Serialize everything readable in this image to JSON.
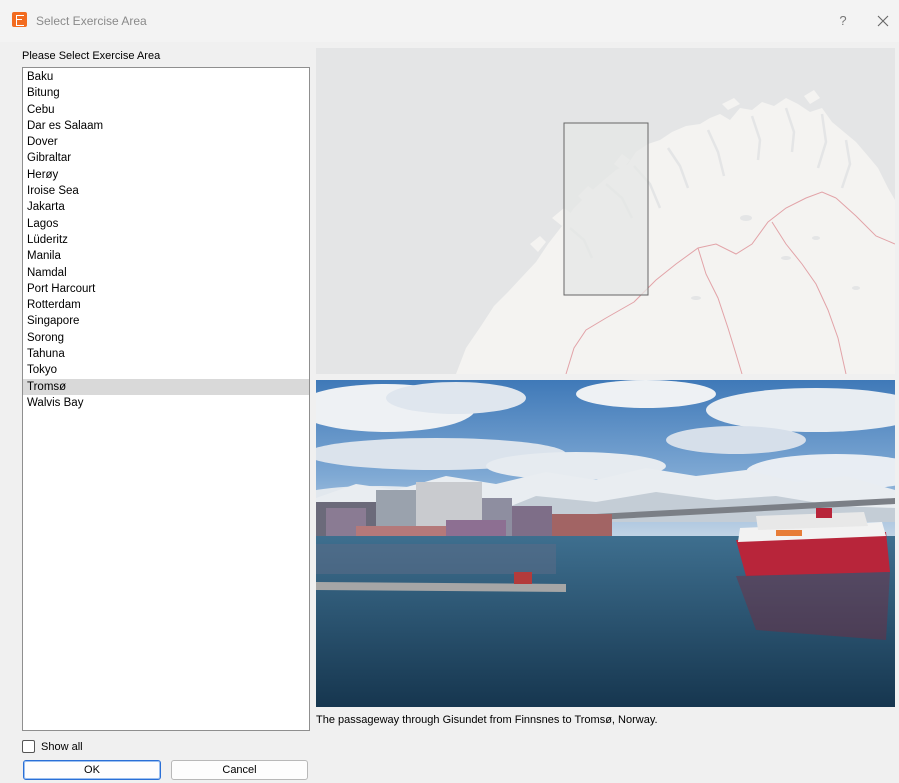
{
  "window": {
    "title": "Select Exercise Area",
    "help_glyph": "?",
    "close_icon": "close-icon"
  },
  "list": {
    "label": "Please Select Exercise Area",
    "items": [
      "Baku",
      "Bitung",
      "Cebu",
      "Dar es Salaam",
      "Dover",
      "Gibraltar",
      "Herøy",
      "Iroise Sea",
      "Jakarta",
      "Lagos",
      "Lüderitz",
      "Manila",
      "Namdal",
      "Port Harcourt",
      "Rotterdam",
      "Singapore",
      "Sorong",
      "Tahuna",
      "Tokyo",
      "Tromsø",
      "Walvis Bay"
    ],
    "selected": "Tromsø"
  },
  "preview": {
    "caption": "The passageway through Gisundet from Finnsnes to Tromsø, Norway."
  },
  "options": {
    "show_all_label": "Show all",
    "show_all_checked": false
  },
  "buttons": {
    "ok_label": "OK",
    "cancel_label": "Cancel"
  },
  "colors": {
    "accent": "#2a6fd6",
    "selection": "#d9d9d9",
    "app_icon": "#f26b1f"
  }
}
